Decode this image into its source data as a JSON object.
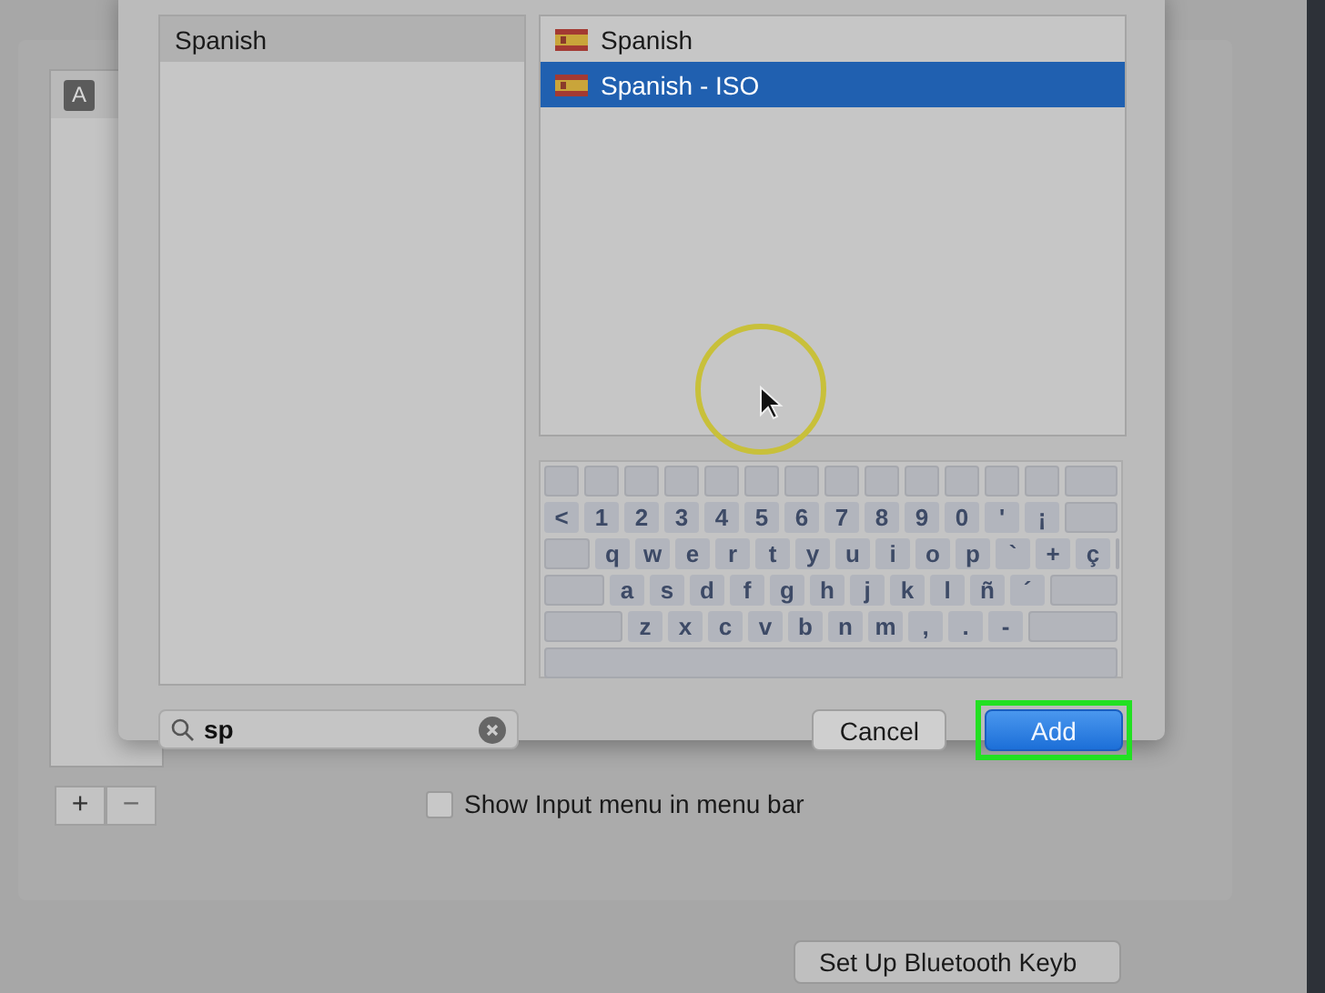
{
  "background_window": {
    "list_icon_letter": "A",
    "add_button": "+",
    "remove_button": "−",
    "show_input_menu": {
      "label": "Show Input menu in menu bar",
      "checked": false
    },
    "bluetooth_button": "Set Up Bluetooth Keyb"
  },
  "dialog": {
    "languages": [
      {
        "label": "Spanish",
        "selected": true
      }
    ],
    "layouts": [
      {
        "label": "Spanish",
        "selected": false
      },
      {
        "label": "Spanish - ISO",
        "selected": true
      }
    ],
    "keyboard_rows": [
      [
        "<",
        "1",
        "2",
        "3",
        "4",
        "5",
        "6",
        "7",
        "8",
        "9",
        "0",
        "'",
        "¡"
      ],
      [
        "q",
        "w",
        "e",
        "r",
        "t",
        "y",
        "u",
        "i",
        "o",
        "p",
        "`",
        "+",
        "ç"
      ],
      [
        "a",
        "s",
        "d",
        "f",
        "g",
        "h",
        "j",
        "k",
        "l",
        "ñ",
        "´"
      ],
      [
        "z",
        "x",
        "c",
        "v",
        "b",
        "n",
        "m",
        ",",
        ".",
        "-"
      ]
    ],
    "search": {
      "value": "sp"
    },
    "buttons": [
      {
        "label": "Cancel",
        "kind": "secondary"
      },
      {
        "label": "Add",
        "kind": "default"
      }
    ]
  }
}
